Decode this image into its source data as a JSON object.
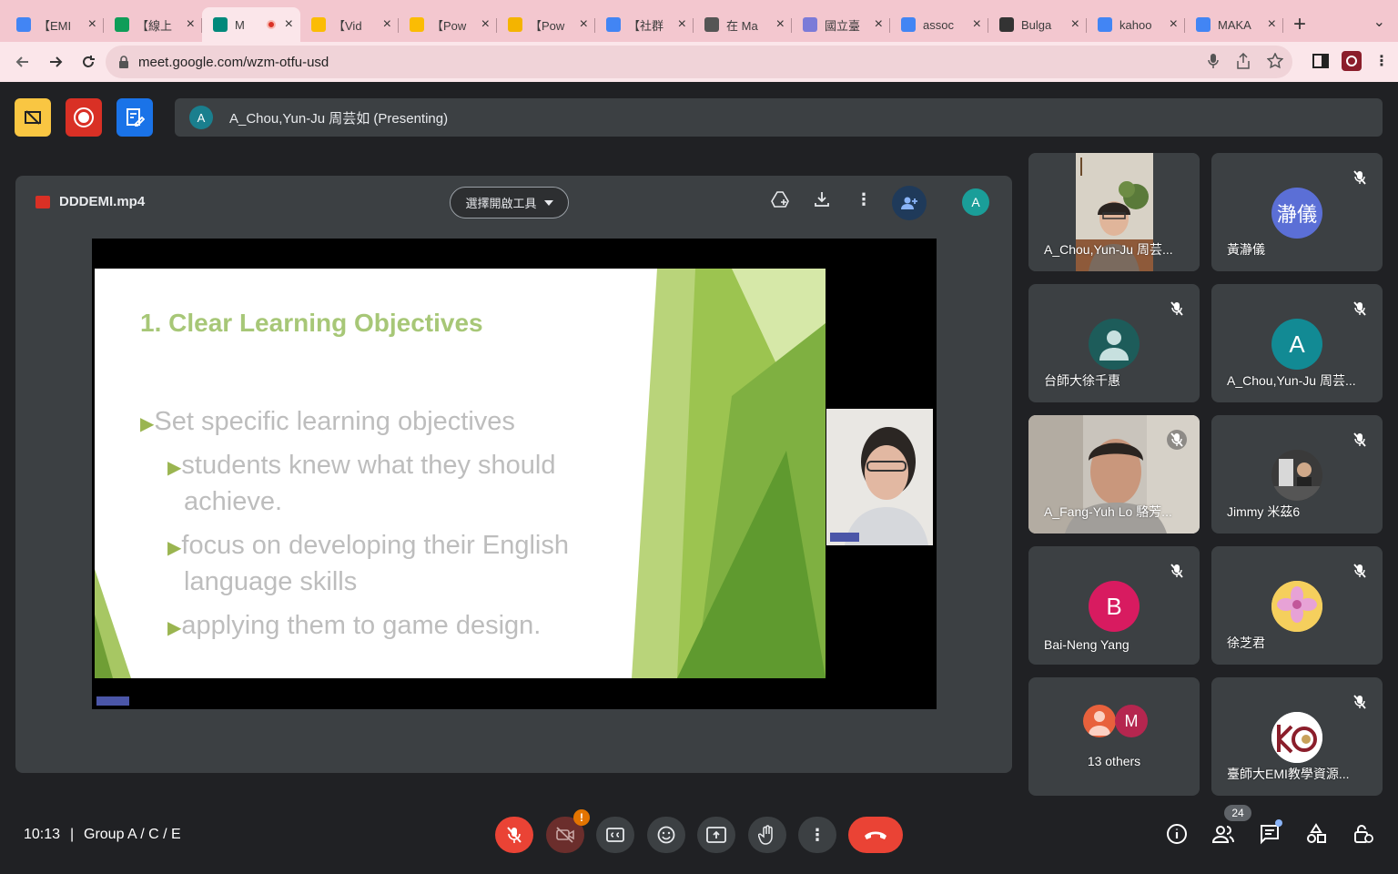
{
  "browser": {
    "tabs": [
      {
        "label": "【EMI",
        "favicon": "docs-icon",
        "color": "#4285f4"
      },
      {
        "label": "【線上",
        "favicon": "sheets-icon",
        "color": "#0f9d58"
      },
      {
        "label": "M",
        "favicon": "meet-icon",
        "color": "#00897b",
        "active": true
      },
      {
        "label": "【Vid",
        "favicon": "drive-icon",
        "color": "#fbbc04"
      },
      {
        "label": "【Pow",
        "favicon": "drive-icon",
        "color": "#fbbc04"
      },
      {
        "label": "【Pow",
        "favicon": "slides-icon",
        "color": "#f4b400"
      },
      {
        "label": "【社群",
        "favicon": "docs-icon",
        "color": "#4285f4"
      },
      {
        "label": "在 Ma",
        "favicon": "apple-icon",
        "color": "#555555"
      },
      {
        "label": "國立臺",
        "favicon": "globe-icon",
        "color": "#7b7bd8"
      },
      {
        "label": "assoc",
        "favicon": "google-icon",
        "color": "#4285f4"
      },
      {
        "label": "Bulga",
        "favicon": "wikipedia-icon",
        "color": "#333333"
      },
      {
        "label": "kahoo",
        "favicon": "google-icon",
        "color": "#4285f4"
      },
      {
        "label": "MAKA",
        "favicon": "google-icon",
        "color": "#4285f4"
      }
    ],
    "url": "meet.google.com/wzm-otfu-usd"
  },
  "meet": {
    "presenter_initial": "A",
    "presenting_text": "A_Chou,Yun-Ju 周芸如 (Presenting)",
    "file_name": "DDDEMI.mp4",
    "open_with_label": "選擇開啟工具",
    "viewer_initial": "A"
  },
  "slide": {
    "title": "1. Clear Learning Objectives",
    "bullets": [
      {
        "level": 1,
        "text": "Set specific learning objectives"
      },
      {
        "level": 2,
        "text": "students knew what they should"
      },
      {
        "level": 2,
        "cont": true,
        "text": "achieve."
      },
      {
        "level": 2,
        "text": "focus on developing their English"
      },
      {
        "level": 2,
        "cont": true,
        "text": "language skills"
      },
      {
        "level": 2,
        "text": "applying them to game design."
      }
    ]
  },
  "participants": [
    {
      "name": "A_Chou,Yun-Ju 周芸...",
      "type": "video",
      "muted": false
    },
    {
      "name": "黃瀞儀",
      "type": "avatar",
      "initial": "瀞儀",
      "color": "#5b6fd6",
      "muted": true
    },
    {
      "name": "台師大徐千惠",
      "type": "default",
      "color": "#1d5c5a",
      "muted": true
    },
    {
      "name": "A_Chou,Yun-Ju 周芸...",
      "type": "avatar",
      "initial": "A",
      "color": "#128a94",
      "muted": true
    },
    {
      "name": "A_Fang-Yuh Lo 駱芳...",
      "type": "video2",
      "muted": true
    },
    {
      "name": "Jimmy 米茲6",
      "type": "photo",
      "muted": true
    },
    {
      "name": "Bai-Neng Yang",
      "type": "avatar",
      "initial": "B",
      "color": "#d81b60",
      "muted": true
    },
    {
      "name": "徐芝君",
      "type": "flower",
      "muted": true
    },
    {
      "name": "13 others",
      "type": "others",
      "initial": "M",
      "muted": false
    },
    {
      "name": "臺師大EMI教學資源...",
      "type": "logo",
      "muted": true
    }
  ],
  "bottom": {
    "time": "10:13",
    "separator": "|",
    "meeting": "Group A / C / E",
    "people_count": "24"
  }
}
